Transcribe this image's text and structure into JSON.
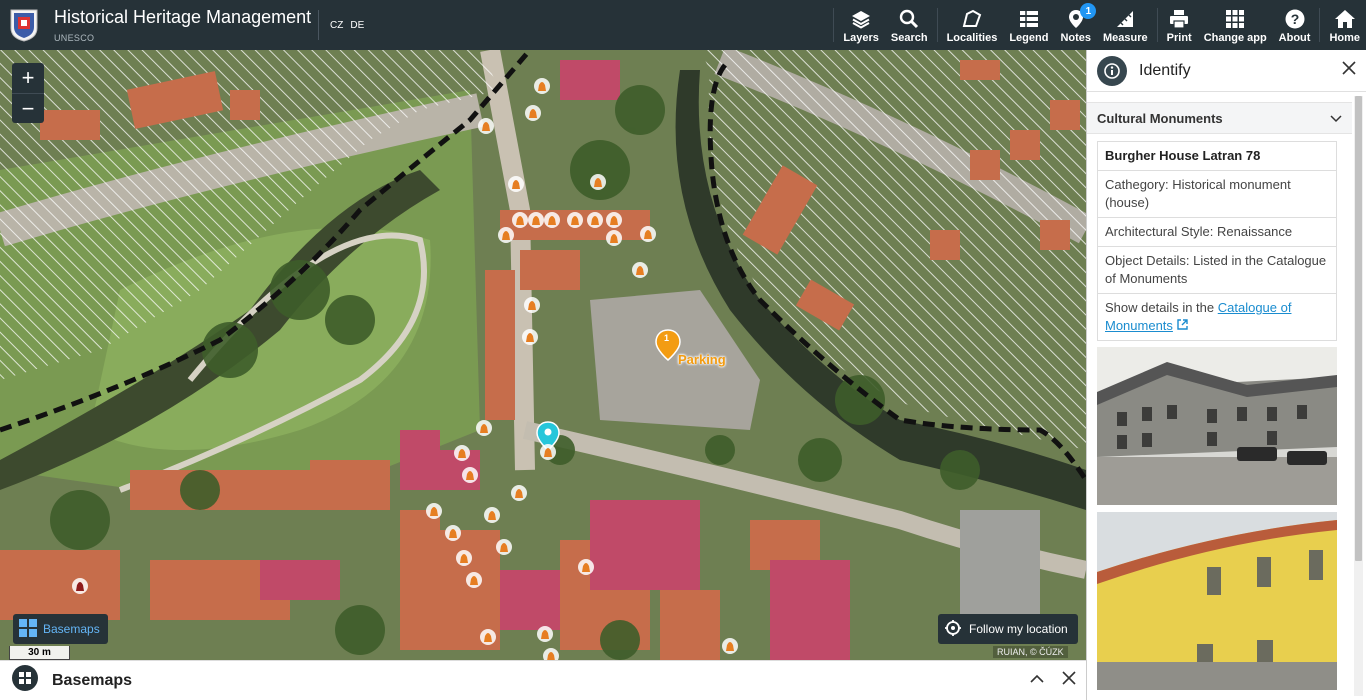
{
  "header": {
    "title": "Historical Heritage Management",
    "subtitle": "UNESCO",
    "languages": [
      "CZ",
      "DE"
    ],
    "brand_color": "#263238",
    "tools": [
      {
        "label": "Layers",
        "icon": "layers-icon"
      },
      {
        "label": "Search",
        "icon": "search-icon"
      },
      {
        "label": "Localities",
        "icon": "localities-icon"
      },
      {
        "label": "Legend",
        "icon": "legend-icon"
      },
      {
        "label": "Notes",
        "icon": "notes-icon",
        "badge": "1"
      },
      {
        "label": "Measure",
        "icon": "measure-icon"
      },
      {
        "label": "Print",
        "icon": "print-icon"
      },
      {
        "label": "Change app",
        "icon": "apps-grid-icon"
      },
      {
        "label": "About",
        "icon": "help-icon"
      },
      {
        "label": "Home",
        "icon": "home-icon"
      }
    ]
  },
  "map": {
    "zoom_in": "+",
    "zoom_out": "−",
    "basemaps_label": "Basemaps",
    "scale_label": "30 m",
    "follow_label": "Follow my location",
    "attribution": "RUIAN, © ČÚZK",
    "parking_count": "1",
    "parking_label": "Parking",
    "marker_color": "#e67e22",
    "selected_marker_color": "#26c6da"
  },
  "identify": {
    "title": "Identify",
    "section_title": "Cultural Monuments",
    "name": "Burgher House Latran 78",
    "category": "Cathegory: Historical monument (house)",
    "style": "Architectural Style: Renaissance",
    "details": "Object Details: Listed in the Catalogue of Monuments",
    "catalogue_prefix": "Show details in the ",
    "catalogue_link": "Catalogue of Monuments"
  },
  "bottom_panel": {
    "title": "Basemaps"
  }
}
